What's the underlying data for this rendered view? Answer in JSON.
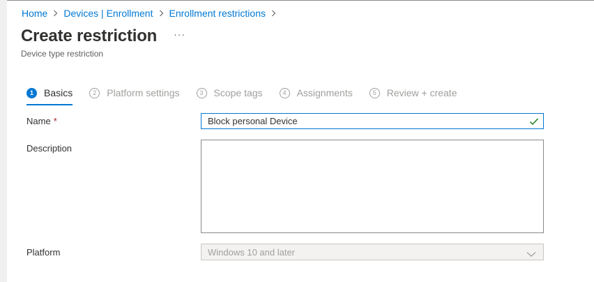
{
  "breadcrumb": [
    {
      "label": "Home"
    },
    {
      "label": "Devices | Enrollment"
    },
    {
      "label": "Enrollment restrictions"
    }
  ],
  "page": {
    "title": "Create restriction",
    "more_label": "···",
    "subtitle": "Device type restriction"
  },
  "wizard": {
    "active_step": 1,
    "steps": [
      {
        "number": "1",
        "label": "Basics"
      },
      {
        "number": "2",
        "label": "Platform settings"
      },
      {
        "number": "3",
        "label": "Scope tags"
      },
      {
        "number": "4",
        "label": "Assignments"
      },
      {
        "number": "5",
        "label": "Review + create"
      }
    ]
  },
  "form": {
    "name": {
      "label": "Name",
      "required_marker": "*",
      "value": "Block personal Device",
      "valid_icon": "checkmark-icon"
    },
    "description": {
      "label": "Description",
      "value": ""
    },
    "platform": {
      "label": "Platform",
      "value": "Windows 10 and later",
      "disabled": true,
      "icon": "chevron-down-icon"
    }
  },
  "colors": {
    "accent": "#0078d4",
    "required": "#a4262c",
    "valid_check": "#107c10",
    "disabled_text": "#a19f9d"
  }
}
